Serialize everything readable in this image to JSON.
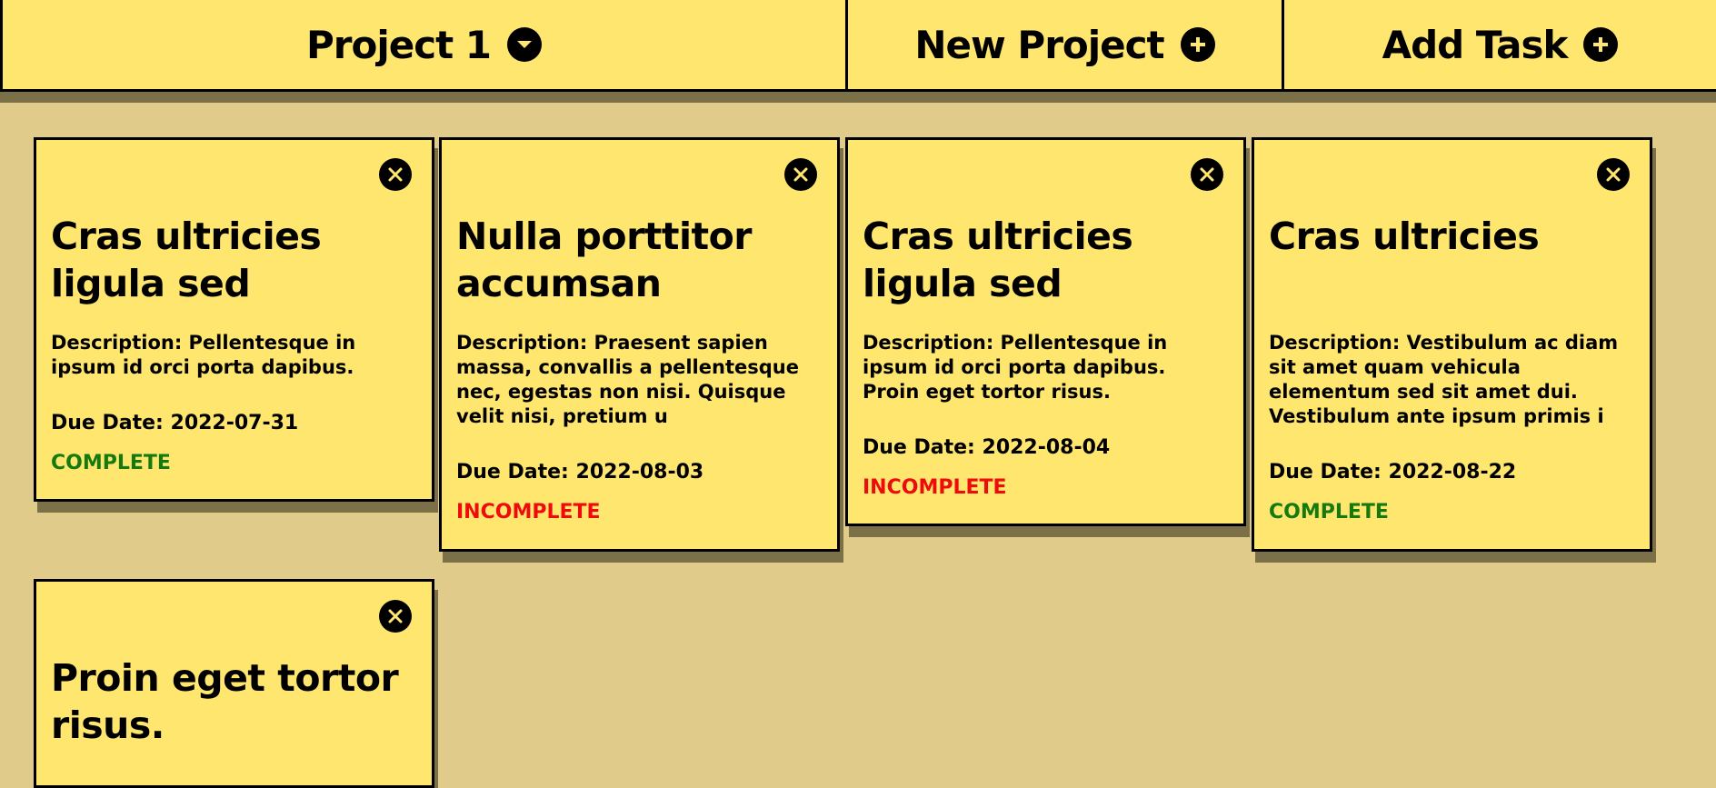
{
  "nav": {
    "project_label": "Project 1",
    "new_project_label": "New Project",
    "add_task_label": "Add Task"
  },
  "colors": {
    "background": "#e0cb8b",
    "card": "#ffe66f",
    "complete": "#157a0d",
    "incomplete": "#ee0b0b"
  },
  "icons": {
    "project_dropdown": "chevron-down-circle-icon",
    "new_project": "plus-circle-icon",
    "add_task": "plus-circle-icon",
    "delete_task": "close-circle-icon"
  },
  "tasks": [
    {
      "title": "Cras ultricies ligula sed",
      "description": "Description: Pellentesque in ipsum id orci porta dapibus.",
      "due": "Due Date: 2022-07-31",
      "status": "COMPLETE"
    },
    {
      "title": "Nulla porttitor accumsan",
      "description": "Description: Praesent sapien massa, convallis a pellentesque nec, egestas non nisi. Quisque velit nisi, pretium u",
      "due": "Due Date: 2022-08-03",
      "status": "INCOMPLETE"
    },
    {
      "title": "Cras ultricies ligula sed",
      "description": "Description: Pellentesque in ipsum id orci porta dapibus. Proin eget tortor risus.",
      "due": "Due Date: 2022-08-04",
      "status": "INCOMPLETE"
    },
    {
      "title": "Cras ultricies",
      "description": "Description: Vestibulum ac diam sit amet quam vehicula elementum sed sit amet dui. Vestibulum ante ipsum primis i",
      "due": "Due Date: 2022-08-22",
      "status": "COMPLETE"
    },
    {
      "title": "Proin eget tortor risus.",
      "description": "",
      "due": "",
      "status": ""
    }
  ]
}
